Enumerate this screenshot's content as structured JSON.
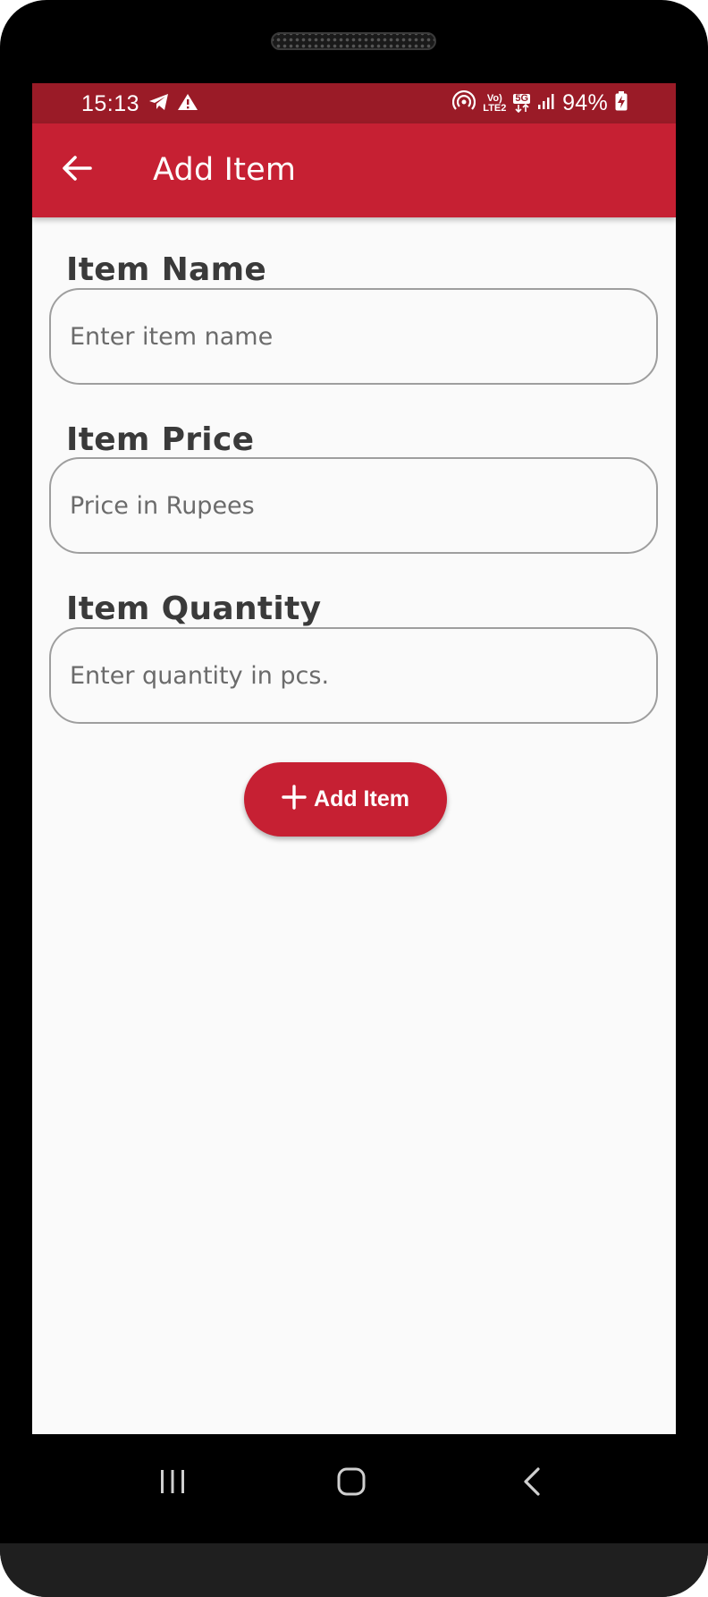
{
  "status_bar": {
    "time": "15:13",
    "network_top": "Vo)",
    "network_bottom": "LTE2",
    "network_type": "5G",
    "battery": "94%",
    "left_icons": [
      "telegram-icon",
      "warning-icon"
    ],
    "right_icons": [
      "hotspot-icon",
      "volte-icon",
      "5g-data-icon",
      "signal-icon",
      "battery-charging-icon"
    ]
  },
  "app_bar": {
    "title": "Add Item",
    "back_icon": "arrow-back-icon"
  },
  "form": {
    "name": {
      "label": "Item Name",
      "placeholder": "Enter item name",
      "value": ""
    },
    "price": {
      "label": "Item Price",
      "placeholder": "Price in Rupees",
      "value": ""
    },
    "quantity": {
      "label": "Item Quantity",
      "placeholder": "Enter quantity in pcs.",
      "value": ""
    },
    "submit": {
      "label": "Add Item",
      "icon": "plus-icon"
    }
  },
  "nav_bar": {
    "buttons": [
      "recent-apps-icon",
      "home-icon",
      "back-icon"
    ]
  },
  "colors": {
    "primary": "#c62033",
    "status_bar": "#9a1b27",
    "background": "#fafafa",
    "label_text": "#3a3a3a",
    "input_border": "#9e9e9e"
  }
}
